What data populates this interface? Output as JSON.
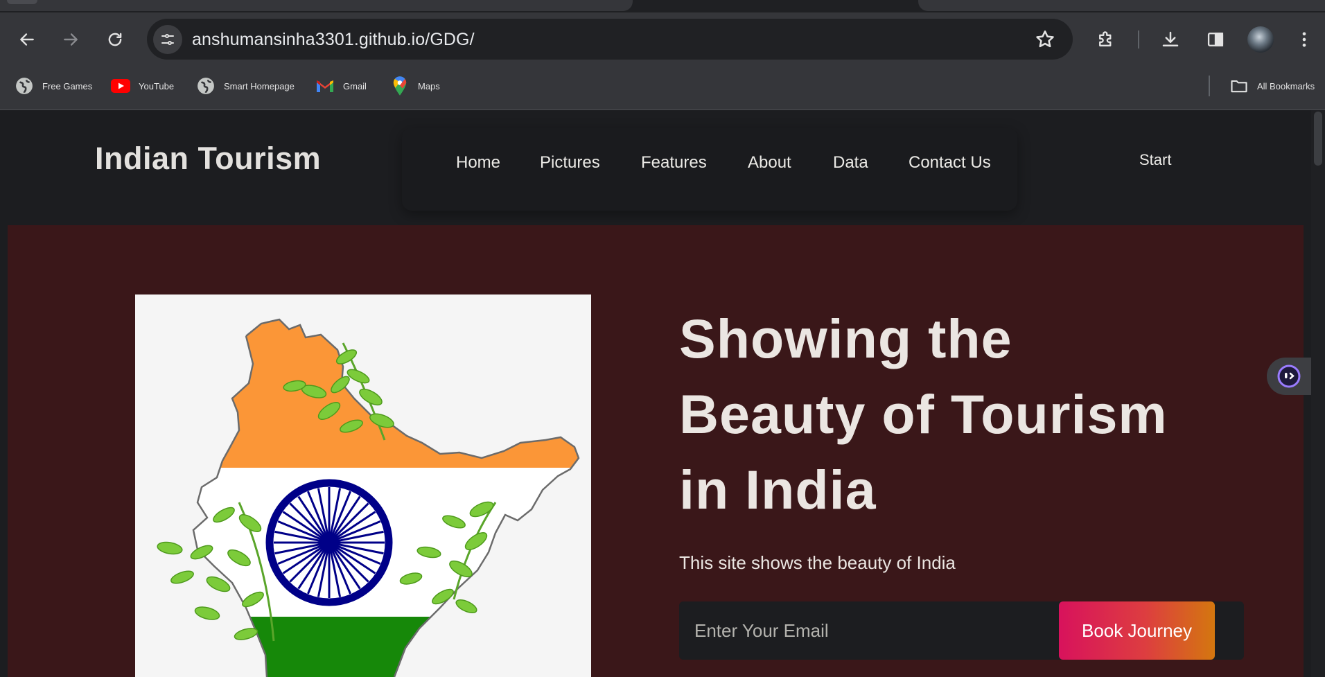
{
  "browser": {
    "url": "anshumansinha3301.github.io/GDG/",
    "bookmarks": [
      {
        "label": "Free Games",
        "icon": "globe-icon"
      },
      {
        "label": "YouTube",
        "icon": "youtube-icon"
      },
      {
        "label": "Smart Homepage",
        "icon": "globe-icon"
      },
      {
        "label": "Gmail",
        "icon": "gmail-icon"
      },
      {
        "label": "Maps",
        "icon": "maps-icon"
      }
    ],
    "all_bookmarks_label": "All Bookmarks",
    "icons": [
      "back-icon",
      "forward-icon",
      "reload-icon",
      "site-info-icon",
      "bookmark-star-icon",
      "extensions-icon",
      "download-icon",
      "side-panel-icon",
      "avatar",
      "more-menu-icon",
      "folder-icon"
    ]
  },
  "site": {
    "logo": "Indian Tourism",
    "nav": [
      "Home",
      "Pictures",
      "Features",
      "About",
      "Data",
      "Contact Us"
    ],
    "start": "Start",
    "hero": {
      "title_lines": [
        "Showing the",
        "Beauty of Tourism",
        "in India"
      ],
      "subtitle": "This site shows the beauty of India",
      "email_placeholder": "Enter Your Email",
      "book_button": "Book Journey"
    }
  },
  "colors": {
    "hero_background": "#3a1719",
    "saffron": "#ff9933",
    "green": "#138808",
    "navy": "#000080",
    "button_gradient": [
      "#d8125c",
      "#d4770f"
    ]
  }
}
